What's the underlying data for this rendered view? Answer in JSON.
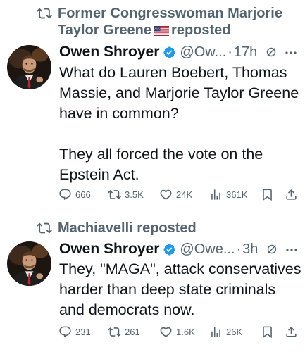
{
  "tweets": [
    {
      "repost_label": "Former Congresswoman Marjorie Taylor Greene",
      "repost_flag": "us-flag",
      "repost_suffix": "reposted",
      "author_name": "Owen Shroyer",
      "author_handle": "@Ow...",
      "time": "17h",
      "text_lines": [
        "What do Lauren Boebert, Thomas Massie, and Marjorie Taylor Greene have in common?",
        "They all forced the vote on the Epstein Act."
      ],
      "replies": "666",
      "reposts": "3.5K",
      "likes": "24K",
      "views": "361K"
    },
    {
      "repost_label": "Machiavelli",
      "repost_suffix": "reposted",
      "author_name": "Owen Shroyer",
      "author_handle": "@Owe...",
      "time": "3h",
      "text_lines": [
        "They, \"MAGA\", attack conservatives harder than deep state criminals and democrats now."
      ],
      "replies": "231",
      "reposts": "261",
      "likes": "1.6K",
      "views": "26K"
    }
  ],
  "colors": {
    "text": "#0f1419",
    "muted": "#536471",
    "verified": "#1d9bf0",
    "divider": "#eff3f4"
  }
}
